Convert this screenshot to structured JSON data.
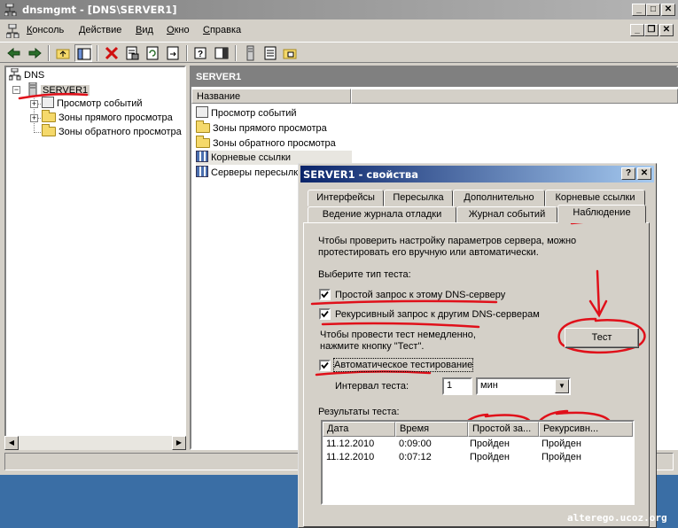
{
  "window": {
    "title": "dnsmgmt - [DNS\\SERVER1]"
  },
  "menu": [
    {
      "label": "Консоль",
      "key": "К",
      "rest": "онсоль"
    },
    {
      "label": "Действие",
      "key": "Д",
      "rest": "ействие"
    },
    {
      "label": "Вид",
      "key": "В",
      "rest": "ид"
    },
    {
      "label": "Окно",
      "key": "О",
      "rest": "кно"
    },
    {
      "label": "Справка",
      "key": "С",
      "rest": "правка"
    }
  ],
  "tree": {
    "root": "DNS",
    "server": "SERVER1",
    "children": [
      "Просмотр событий",
      "Зоны прямого просмотра",
      "Зоны обратного просмотра"
    ]
  },
  "right_pane": {
    "header": "SERVER1",
    "column": "Название",
    "items": [
      "Просмотр событий",
      "Зоны прямого просмотра",
      "Зоны обратного просмотра",
      "Корневые ссылки",
      "Серверы пересылки"
    ]
  },
  "dialog": {
    "title": "SERVER1 - свойства",
    "help_btn": "?",
    "close_btn": "✕",
    "tabs_row1": [
      "Интерфейсы",
      "Пересылка",
      "Дополнительно",
      "Корневые ссылки"
    ],
    "tabs_row2": [
      "Ведение журнала отладки",
      "Журнал событий",
      "Наблюдение"
    ],
    "intro_line1": "Чтобы проверить настройку параметров сервера, можно",
    "intro_line2": "протестировать его вручную или автоматически.",
    "select_type": "Выберите тип теста:",
    "cb_simple": "Простой запрос к этому DNS-серверу",
    "cb_recursive": "Рекурсивный запрос к другим DNS-серверам",
    "now_line1": "Чтобы провести тест немедленно,",
    "now_line2": "нажмите кнопку \"Тест\".",
    "test_button": "Тест",
    "cb_auto": "Автоматическое тестирование",
    "interval_label": "Интервал теста:",
    "interval_value": "1",
    "interval_unit": "мин",
    "results_label": "Результаты теста:",
    "results_cols": [
      "Дата",
      "Время",
      "Простой за...",
      "Рекурсивн..."
    ],
    "results_rows": [
      [
        "11.12.2010",
        "0:09:00",
        "Пройден",
        "Пройден"
      ],
      [
        "11.12.2010",
        "0:07:12",
        "Пройден",
        "Пройден"
      ]
    ]
  },
  "watermark": "alterego.ucoz.org",
  "colors": {
    "annotation_red": "#e0101a",
    "desktop": "#3a6ea5"
  }
}
